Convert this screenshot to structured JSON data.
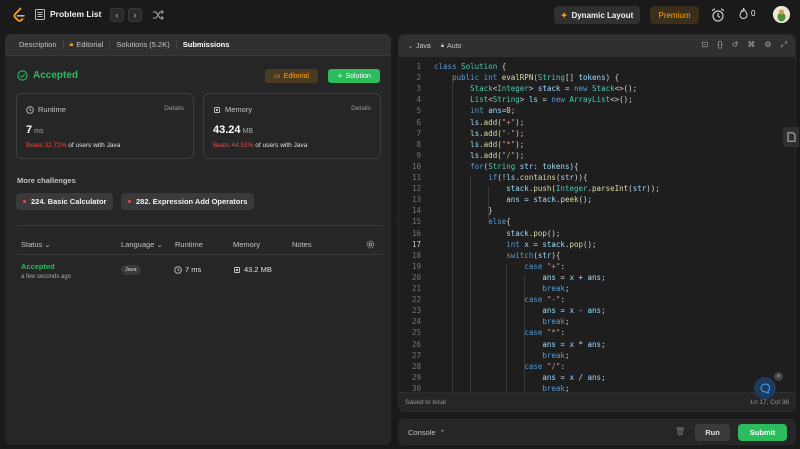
{
  "topbar": {
    "title": "Problem List",
    "dynamic_layout": "Dynamic Layout",
    "premium": "Premium",
    "streak_count": "0"
  },
  "left_tabs": [
    {
      "label": "Description"
    },
    {
      "label": "Editorial"
    },
    {
      "label": "Solutions (5.2K)"
    },
    {
      "label": "Submissions"
    }
  ],
  "result": {
    "status": "Accepted",
    "editorial_label": "Editorial",
    "solution_label": "Solution"
  },
  "runtime": {
    "label": "Runtime",
    "details": "Details",
    "value": "7",
    "unit": "ms",
    "beats_pct": "Beats 32.72%",
    "beats_text": "of users with Java"
  },
  "memory": {
    "label": "Memory",
    "details": "Details",
    "value": "43.24",
    "unit": "MB",
    "beats_pct": "Beats 44.52%",
    "beats_text": "of users with Java"
  },
  "more_challenges": {
    "heading": "More challenges",
    "items": [
      "224. Basic Calculator",
      "282. Expression Add Operators"
    ]
  },
  "table": {
    "headers": {
      "status": "Status",
      "language": "Language",
      "runtime": "Runtime",
      "memory": "Memory",
      "notes": "Notes"
    },
    "row": {
      "status": "Accepted",
      "time": "a few seconds ago",
      "language": "Java",
      "runtime": "7 ms",
      "memory": "43.2 MB"
    }
  },
  "editor": {
    "language": "Java",
    "mode": "Auto",
    "saved": "Saved to local",
    "cursor": "Ln 17, Col 36",
    "current_line": 17
  },
  "console": {
    "label": "Console",
    "run": "Run",
    "submit": "Submit"
  },
  "colors": {
    "accent_green": "#2cbb5d",
    "accent_orange": "#ffa116",
    "beats_red": "#ef4743"
  }
}
